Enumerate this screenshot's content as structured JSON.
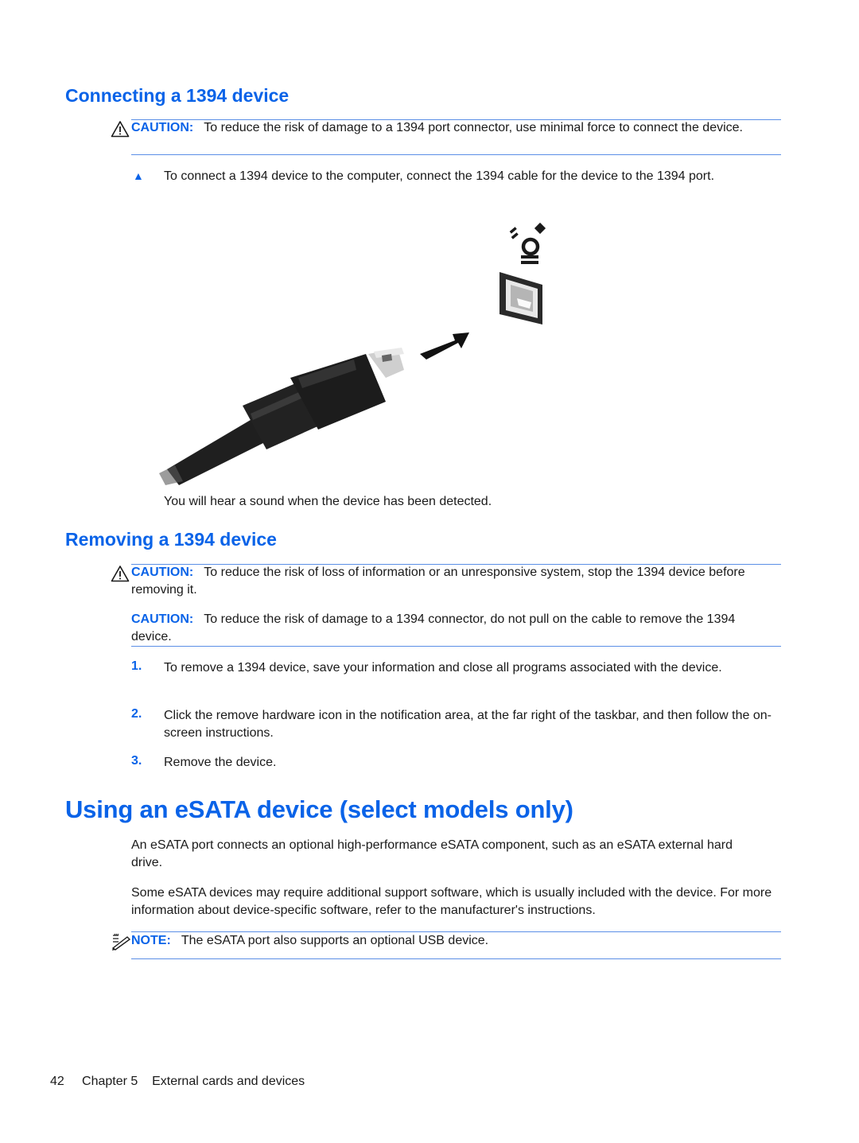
{
  "section_connect": {
    "heading": "Connecting a 1394 device",
    "caution": {
      "label": "CAUTION:",
      "text": "To reduce the risk of damage to a 1394 port connector, use minimal force to connect the device."
    },
    "step_text": "To connect a 1394 device to the computer, connect the 1394 cable for the device to the 1394 port.",
    "illustration_alt": "1394 cable plugging into 1394 port",
    "after_text": "You will hear a sound when the device has been detected."
  },
  "section_remove": {
    "heading": "Removing a 1394 device",
    "caution1": {
      "label": "CAUTION:",
      "text": "To reduce the risk of loss of information or an unresponsive system, stop the 1394 device before removing it."
    },
    "caution2": {
      "label": "CAUTION:",
      "text": "To reduce the risk of damage to a 1394 connector, do not pull on the cable to remove the 1394 device."
    },
    "steps": [
      {
        "num": "1.",
        "text": "To remove a 1394 device, save your information and close all programs associated with the device."
      },
      {
        "num": "2.",
        "text": "Click the remove hardware icon in the notification area, at the far right of the taskbar, and then follow the on-screen instructions."
      },
      {
        "num": "3.",
        "text": "Remove the device."
      }
    ]
  },
  "section_esata": {
    "heading": "Using an eSATA device (select models only)",
    "para1": "An eSATA port connects an optional high-performance eSATA component, such as an eSATA external hard drive.",
    "para2": "Some eSATA devices may require additional support software, which is usually included with the device. For more information about device-specific software, refer to the manufacturer's instructions.",
    "note": {
      "label": "NOTE:",
      "text": "The eSATA port also supports an optional USB device."
    }
  },
  "footer": {
    "page_number": "42",
    "chapter": "Chapter 5",
    "chapter_title": "External cards and devices"
  },
  "colors": {
    "accent": "#0a63e8",
    "rule": "#5b8fe6",
    "text": "#1a1a1a"
  }
}
